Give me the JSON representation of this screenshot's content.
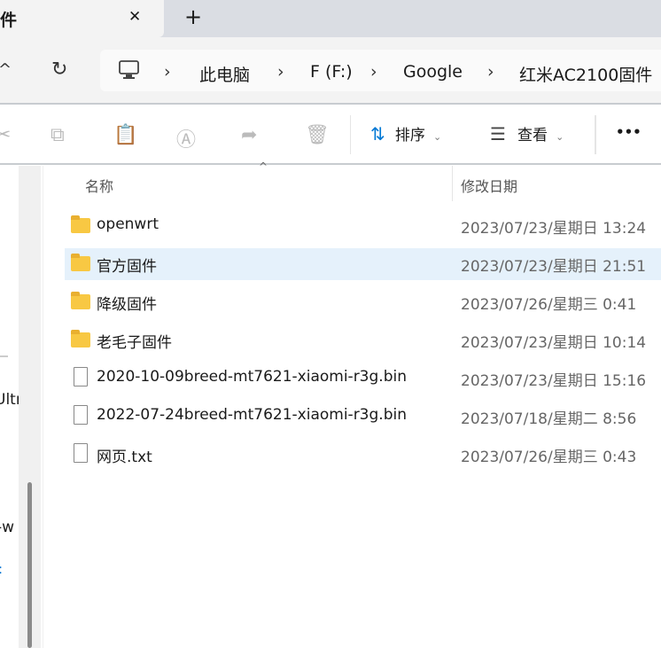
{
  "tabs": {
    "active_title_fragment": "件",
    "close": "✕",
    "new_tab": "+"
  },
  "nav": {
    "up": "^",
    "refresh": "↻"
  },
  "breadcrumb": [
    "此电脑",
    "F (F:)",
    "Google",
    "红米AC2100固件"
  ],
  "toolbar": {
    "sort_label": "排序",
    "view_label": "查看",
    "more": "•••"
  },
  "columns": {
    "name": "名称",
    "modified": "修改日期"
  },
  "files": [
    {
      "name": "openwrt",
      "modified": "2023/07/23/星期日 13:24",
      "type": "folder"
    },
    {
      "name": "官方固件",
      "modified": "2023/07/23/星期日 21:51",
      "type": "folder",
      "selected": true
    },
    {
      "name": "降级固件",
      "modified": "2023/07/26/星期三 0:41",
      "type": "folder"
    },
    {
      "name": "老毛子固件",
      "modified": "2023/07/23/星期日 10:14",
      "type": "folder"
    },
    {
      "name": "2020-10-09breed-mt7621-xiaomi-r3g.bin",
      "modified": "2023/07/23/星期日 15:16",
      "type": "file"
    },
    {
      "name": "2022-07-24breed-mt7621-xiaomi-r3g.bin",
      "modified": "2023/07/18/星期二 8:56",
      "type": "file"
    },
    {
      "name": "网页.txt",
      "modified": "2023/07/26/星期三 0:43",
      "type": "text"
    }
  ],
  "sidebar": {
    "fragments": [
      "Ultr",
      "-w",
      ":"
    ]
  },
  "colors": {
    "selected_row": "#e5f1fb",
    "folder": "#f8c843",
    "accent": "#0078d4"
  }
}
